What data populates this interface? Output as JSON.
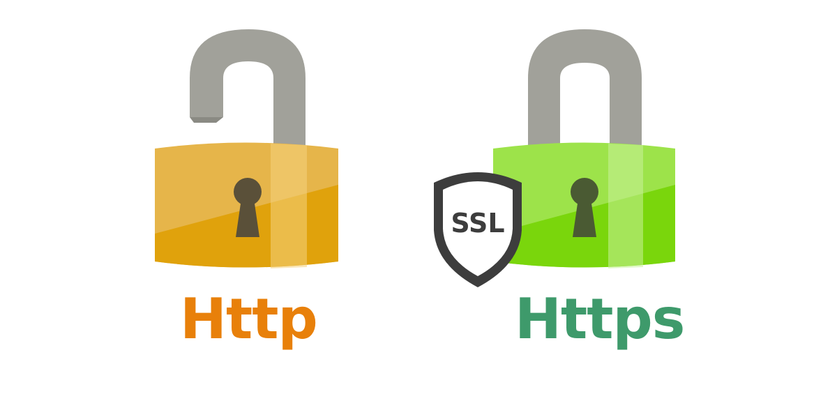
{
  "labels": {
    "http": "Http",
    "https": "Https",
    "badge": "SSL"
  },
  "colors": {
    "http_text": "#e8800a",
    "https_text": "#3e9a6b",
    "open_lock_body": "#e6b54a",
    "open_lock_body_dark": "#e0a20c",
    "closed_lock_body": "#9de34a",
    "closed_lock_body_dark": "#7ad60c",
    "shackle": "#a1a19a",
    "keyhole": "#5a5039",
    "shield_border": "#3d3d3d"
  },
  "icons": {
    "open_lock": "open-padlock-icon",
    "closed_lock": "closed-padlock-icon",
    "badge": "ssl-shield-icon"
  }
}
